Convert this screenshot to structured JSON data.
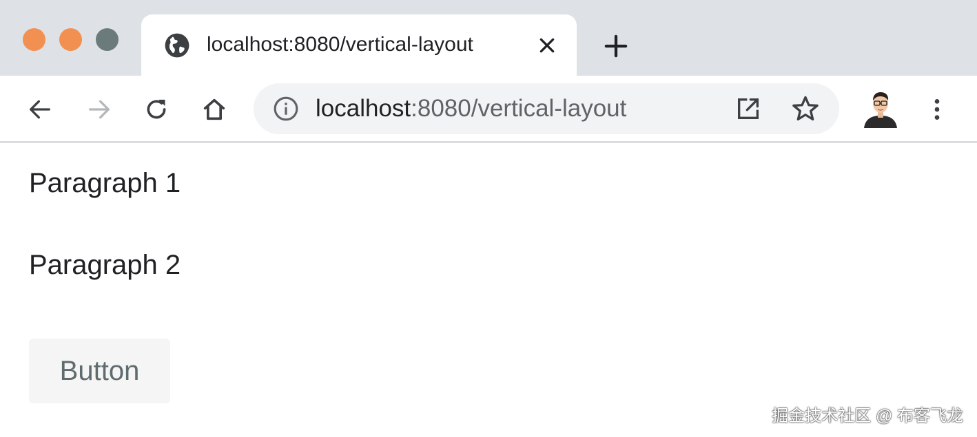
{
  "window": {
    "traffic_lights": {
      "close": "#f19050",
      "minimize": "#f19050",
      "maximize": "#6b7b7b"
    }
  },
  "tab": {
    "favicon": "globe-icon",
    "title": "localhost:8080/vertical-layout",
    "close_icon": "close-icon"
  },
  "new_tab_icon": "plus-icon",
  "toolbar": {
    "back_icon": "arrow-left-icon",
    "forward_icon": "arrow-right-icon",
    "reload_icon": "reload-icon",
    "home_icon": "home-icon"
  },
  "omnibox": {
    "info_icon": "info-icon",
    "url_host": "localhost",
    "url_path": ":8080/vertical-layout",
    "open_icon": "open-external-icon",
    "star_icon": "star-icon"
  },
  "profile": {
    "avatar": "avatar"
  },
  "menu_icon": "more-vert-icon",
  "page": {
    "paragraph_1": "Paragraph 1",
    "paragraph_2": "Paragraph 2",
    "button_label": "Button"
  },
  "watermark": "掘金技术社区 @ 布客飞龙",
  "colors": {
    "tab_strip": "#dee1e6",
    "omnibox_bg": "#f1f3f4",
    "button_bg": "#f5f5f5",
    "button_text": "#5f6b6e"
  }
}
